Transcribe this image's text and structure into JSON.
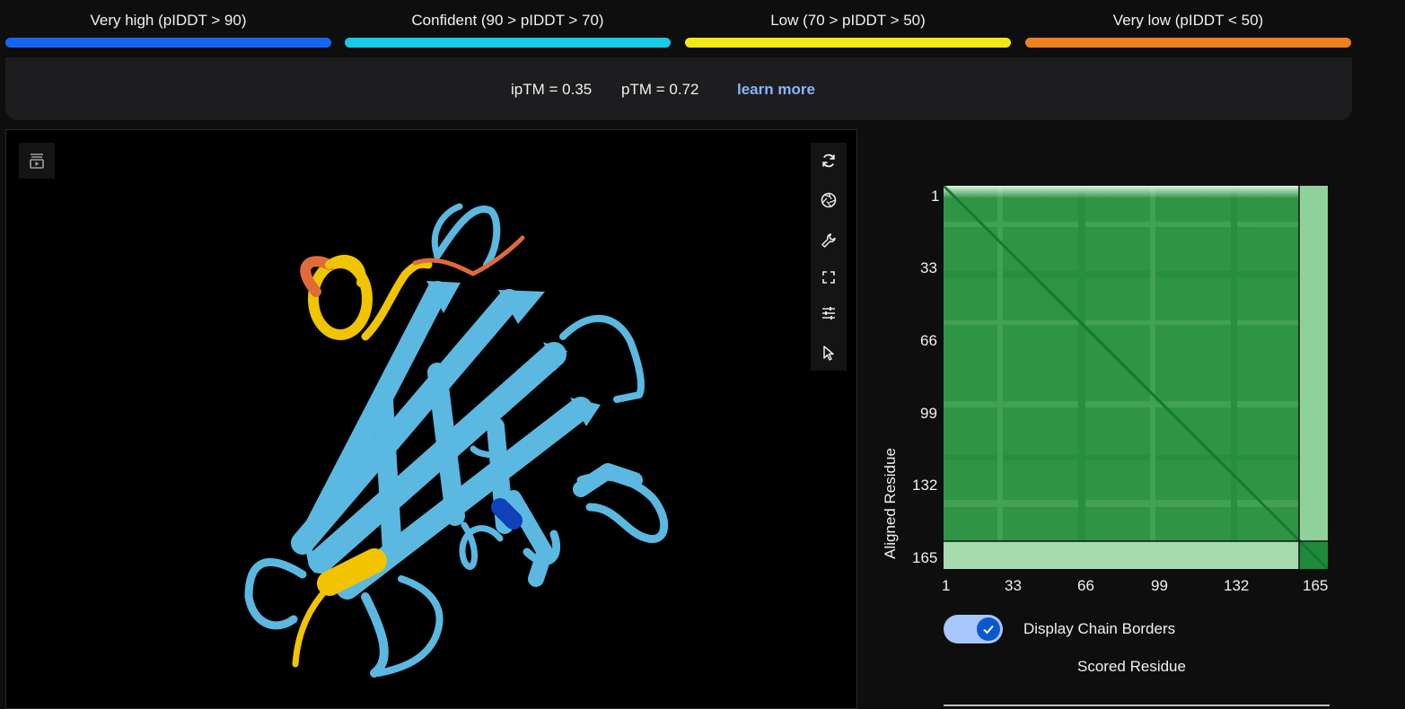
{
  "legend": [
    {
      "label": "Very high (pIDDT > 90)",
      "color": "#1565f5"
    },
    {
      "label": "Confident (90 > pIDDT > 70)",
      "color": "#17cbe6"
    },
    {
      "label": "Low (70 > pIDDT > 50)",
      "color": "#f2e914"
    },
    {
      "label": "Very low (pIDDT < 50)",
      "color": "#f0801e"
    }
  ],
  "metrics": {
    "iptm": "ipTM = 0.35",
    "ptm": "pTM = 0.72",
    "learn_more": "learn more"
  },
  "viewer": {
    "tools": [
      "sequence-play-icon",
      "rotate-icon",
      "camera-icon",
      "wrench-icon",
      "fullscreen-icon",
      "sliders-icon",
      "pointer-icon"
    ]
  },
  "pae": {
    "ylabel": "Aligned Residue",
    "xlabel": "Scored Residue",
    "yticks": [
      "1",
      "33",
      "66",
      "99",
      "132",
      "165"
    ],
    "xticks": [
      "1",
      "33",
      "66",
      "99",
      "132",
      "165"
    ],
    "toggle_label": "Display Chain Borders",
    "toggle_on": true,
    "heatmap_color": "#1f8a3c"
  }
}
